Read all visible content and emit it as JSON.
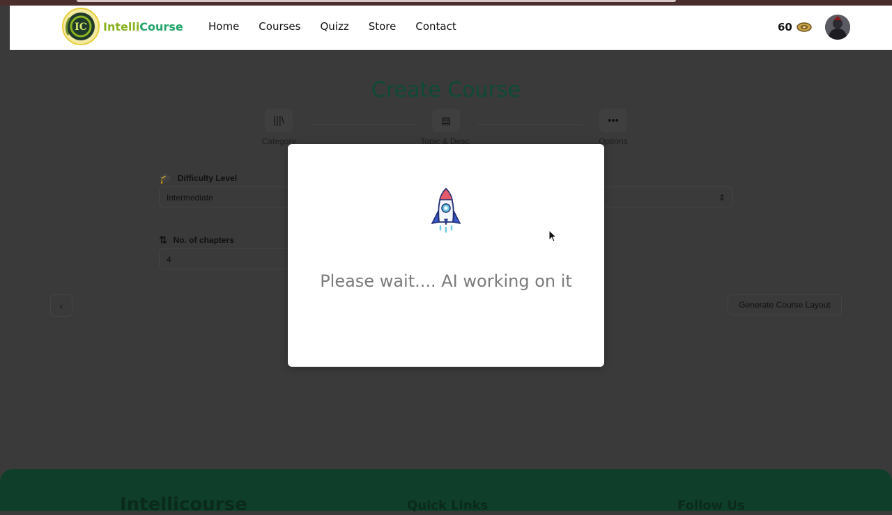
{
  "nav": {
    "brand_part1": "Intelli",
    "brand_part2": "Course",
    "links": [
      "Home",
      "Courses",
      "Quizz",
      "Store",
      "Contact"
    ],
    "coin_count": "60"
  },
  "page": {
    "title": "Create Course",
    "steps": [
      "Category",
      "Topic & Desc.",
      "Options"
    ],
    "difficulty_label": "Difficulty Level",
    "difficulty_value": "Intermediate",
    "chapters_label": "No. of chapters",
    "chapters_value": "4",
    "generate_button": "Generate Course Layout"
  },
  "footer": {
    "col1": "Intellicourse",
    "col2": "Quick Links",
    "col3": "Follow Us"
  },
  "modal": {
    "message": "Please wait.... AI working on it",
    "icon": "rocket-icon"
  },
  "colors": {
    "brand_green": "#23a36b",
    "brand_lime": "#8ab21f",
    "overlay": "#3a3a3a",
    "modal_text": "#7b7b7b"
  }
}
